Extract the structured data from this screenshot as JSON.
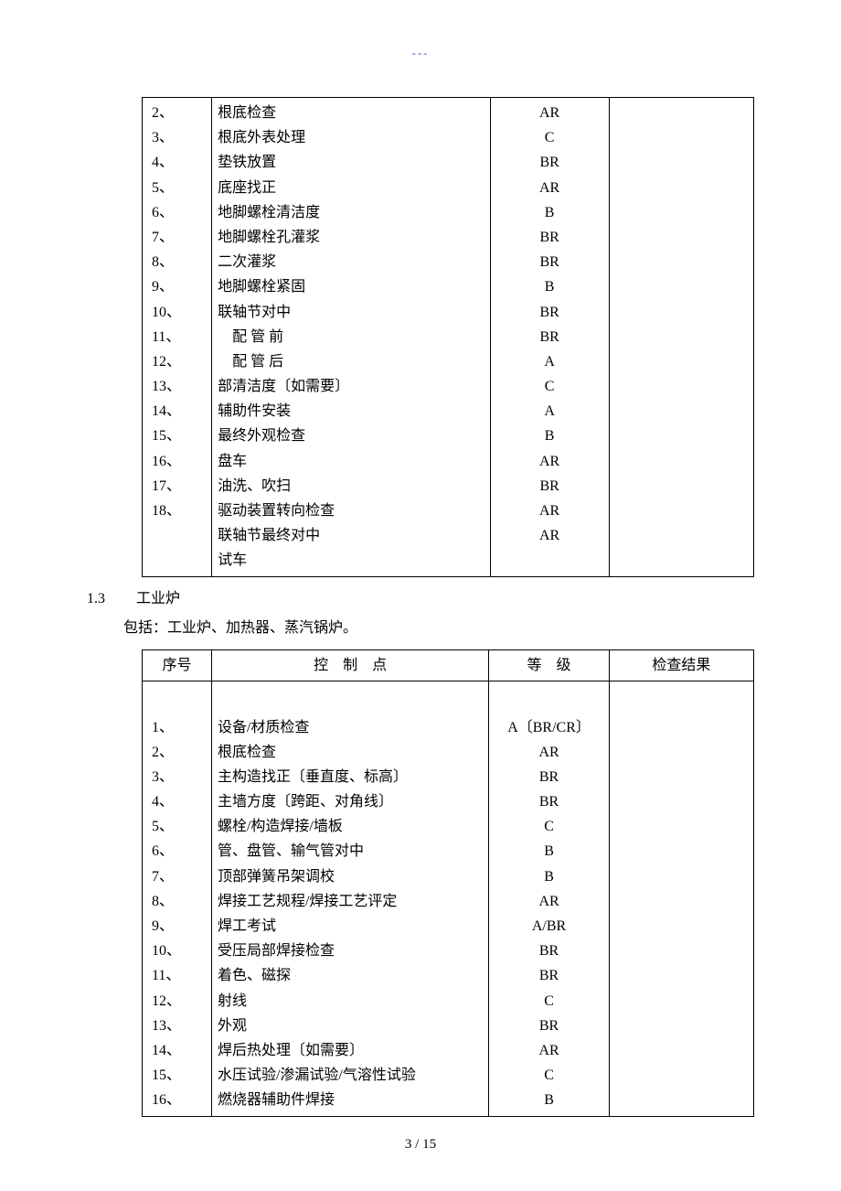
{
  "header_dash": "---",
  "table1_rows": [
    {
      "n": "2、",
      "ctrl": "根底检查",
      "grade": "AR"
    },
    {
      "n": "3、",
      "ctrl": "根底外表处理",
      "grade": "C"
    },
    {
      "n": "4、",
      "ctrl": "垫铁放置",
      "grade": "BR"
    },
    {
      "n": "5、",
      "ctrl": "底座找正",
      "grade": "AR"
    },
    {
      "n": "6、",
      "ctrl": "地脚螺栓清洁度",
      "grade": "B"
    },
    {
      "n": "7、",
      "ctrl": "地脚螺栓孔灌浆",
      "grade": "BR"
    },
    {
      "n": "8、",
      "ctrl": "二次灌浆",
      "grade": "BR"
    },
    {
      "n": "9、",
      "ctrl": "地脚螺栓紧固",
      "grade": "B"
    },
    {
      "n": "10、",
      "ctrl": "联轴节对中",
      "grade": "BR"
    },
    {
      "n": "11、",
      "ctrl": "　配 管 前",
      "grade": "BR"
    },
    {
      "n": "12、",
      "ctrl": "　配 管 后",
      "grade": "A"
    },
    {
      "n": "13、",
      "ctrl": "部清洁度〔如需要〕",
      "grade": "C"
    },
    {
      "n": "14、",
      "ctrl": "辅助件安装",
      "grade": "A"
    },
    {
      "n": "15、",
      "ctrl": "最终外观检查",
      "grade": "B"
    },
    {
      "n": "16、",
      "ctrl": "盘车",
      "grade": "AR"
    },
    {
      "n": "17、",
      "ctrl": "油洗、吹扫",
      "grade": "BR"
    },
    {
      "n": "18、",
      "ctrl": "驱动装置转向检查",
      "grade": "AR"
    },
    {
      "n": "",
      "ctrl": "联轴节最终对中",
      "grade": "AR"
    },
    {
      "n": "",
      "ctrl": "试车",
      "grade": ""
    }
  ],
  "section": {
    "num": "1.3",
    "title": "工业炉",
    "sub": "包括：工业炉、加热器、蒸汽锅炉。"
  },
  "table2_head": {
    "c1": "序号",
    "c2": "控　制　点",
    "c3": "等　级",
    "c4": "检查结果"
  },
  "table2_rows": [
    {
      "n": "1、",
      "ctrl": "设备/材质检查",
      "grade": "A〔BR/CR〕"
    },
    {
      "n": "2、",
      "ctrl": "根底检查",
      "grade": "AR"
    },
    {
      "n": "3、",
      "ctrl": "主构造找正〔垂直度、标高〕",
      "grade": "BR"
    },
    {
      "n": "4、",
      "ctrl": "主墙方度〔跨距、对角线〕",
      "grade": "BR"
    },
    {
      "n": "5、",
      "ctrl": "螺栓/构造焊接/墙板",
      "grade": "C"
    },
    {
      "n": "6、",
      "ctrl": "管、盘管、输气管对中",
      "grade": "B"
    },
    {
      "n": "7、",
      "ctrl": "顶部弹簧吊架调校",
      "grade": "B"
    },
    {
      "n": "8、",
      "ctrl": "焊接工艺规程/焊接工艺评定",
      "grade": "AR"
    },
    {
      "n": "9、",
      "ctrl": "焊工考试",
      "grade": "A/BR"
    },
    {
      "n": "10、",
      "ctrl": "受压局部焊接检查",
      "grade": "BR"
    },
    {
      "n": "11、",
      "ctrl": "着色、磁探",
      "grade": "BR"
    },
    {
      "n": "12、",
      "ctrl": "射线",
      "grade": "C"
    },
    {
      "n": "13、",
      "ctrl": "外观",
      "grade": "BR"
    },
    {
      "n": "14、",
      "ctrl": "焊后热处理〔如需要〕",
      "grade": "AR"
    },
    {
      "n": "15、",
      "ctrl": "水压试验/渗漏试验/气溶性试验",
      "grade": "C"
    },
    {
      "n": "16、",
      "ctrl": "燃烧器辅助件焊接",
      "grade": "B"
    }
  ],
  "page_num": "3 / 15"
}
